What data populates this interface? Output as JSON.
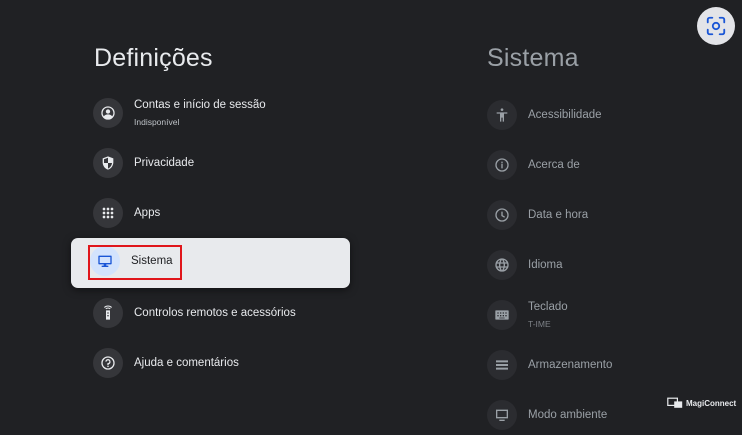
{
  "left_panel": {
    "title": "Definições",
    "items": [
      {
        "label": "Contas e início de sessão",
        "sublabel": "Indisponível",
        "icon": "account-circle-icon"
      },
      {
        "label": "Privacidade",
        "icon": "shield-icon"
      },
      {
        "label": "Apps",
        "icon": "apps-grid-icon"
      },
      {
        "label": "Sistema",
        "icon": "tv-monitor-icon",
        "selected": true
      },
      {
        "label": "Controlos remotos e acessórios",
        "icon": "remote-icon"
      },
      {
        "label": "Ajuda e comentários",
        "icon": "help-icon"
      }
    ]
  },
  "right_panel": {
    "title": "Sistema",
    "items": [
      {
        "label": "Acessibilidade",
        "icon": "accessibility-icon"
      },
      {
        "label": "Acerca de",
        "icon": "info-icon"
      },
      {
        "label": "Data e hora",
        "icon": "clock-icon"
      },
      {
        "label": "Idioma",
        "icon": "globe-icon"
      },
      {
        "label": "Teclado",
        "sublabel": "T-IME",
        "icon": "keyboard-icon"
      },
      {
        "label": "Armazenamento",
        "icon": "storage-icon"
      },
      {
        "label": "Modo ambiente",
        "icon": "ambient-icon"
      }
    ]
  },
  "watermark": {
    "text": "MagiConnect"
  },
  "colors": {
    "background": "#202124",
    "selected_card": "#e8eaed",
    "highlight": "#e0161b",
    "accent": "#1a56d6"
  }
}
